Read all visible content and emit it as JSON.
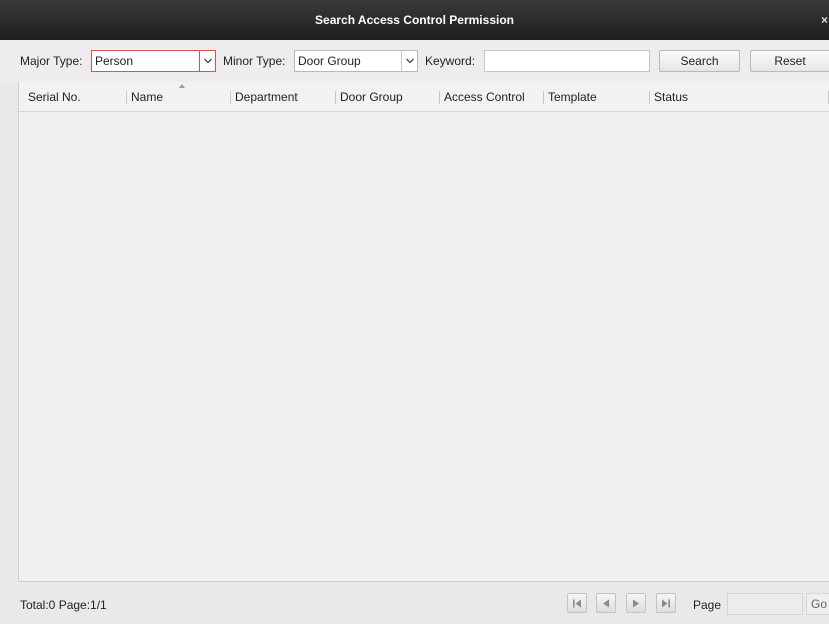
{
  "window": {
    "title": "Search Access Control Permission",
    "close_glyph": "×"
  },
  "filters": {
    "major_type_label": "Major Type:",
    "major_type_value": "Person",
    "minor_type_label": "Minor Type:",
    "minor_type_value": "Door Group",
    "keyword_label": "Keyword:",
    "keyword_value": "",
    "search_label": "Search",
    "reset_label": "Reset"
  },
  "table": {
    "columns": [
      "Serial No.",
      "Name",
      "Department",
      "Door Group",
      "Access Control",
      "Template",
      "Status"
    ],
    "sorted_column": "Name",
    "sort_direction": "ascending",
    "rows": []
  },
  "footer": {
    "total_text": "Total:0  Page:1/1",
    "page_label": "Page",
    "page_value": "",
    "go_label": "Go"
  },
  "icons": {
    "first_page": "first-page-icon",
    "prev_page": "previous-page-icon",
    "next_page": "next-page-icon",
    "last_page": "last-page-icon",
    "dropdown": "chevron-down-icon",
    "sort": "sort-ascending-icon",
    "close": "close-icon"
  },
  "colors": {
    "titlebar": "#262626",
    "active_border": "#d9534f",
    "dialog_bg": "#e9e9e9"
  }
}
